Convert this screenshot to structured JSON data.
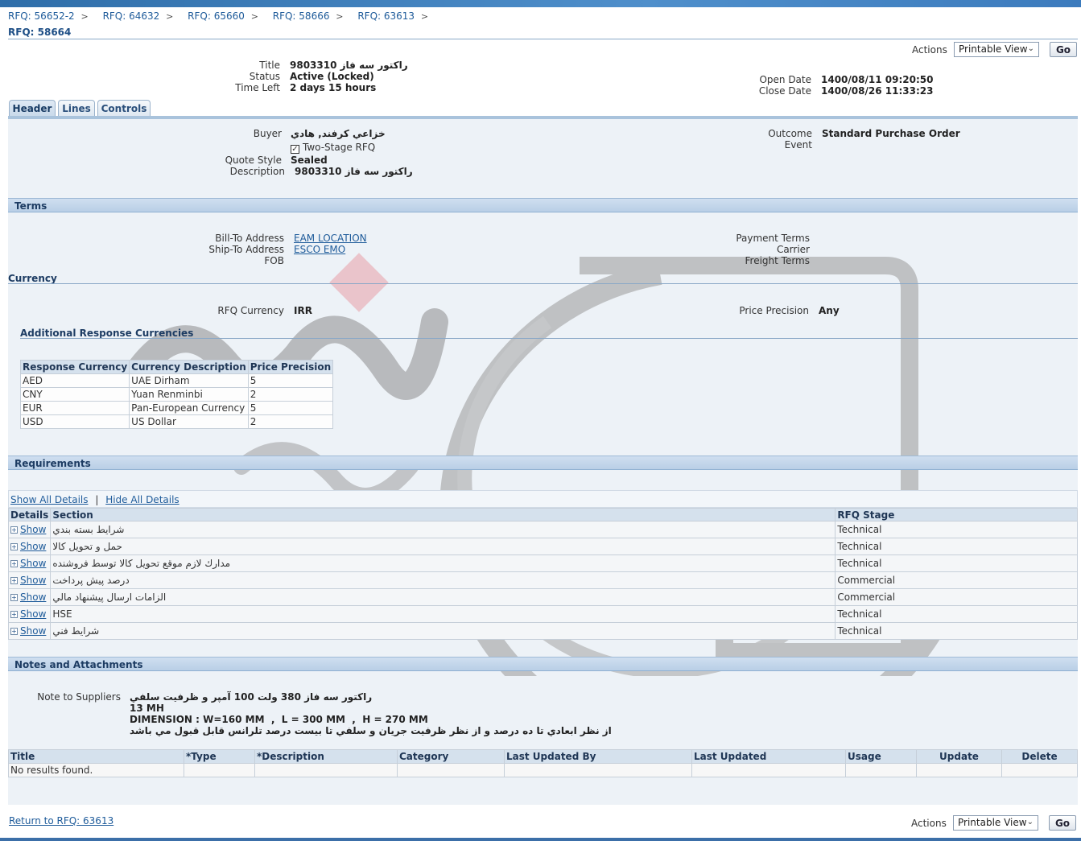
{
  "breadcrumbs": [
    "RFQ: 56652-2",
    "RFQ: 64632",
    "RFQ: 65660",
    "RFQ: 58666",
    "RFQ: 63613"
  ],
  "breadcrumb_sep": ">",
  "page_title": "RFQ: 58664",
  "actions": {
    "label": "Actions",
    "selected": "Printable View",
    "go": "Go"
  },
  "header_info": {
    "title_label": "Title",
    "title_value": "9803310 راكتور سه فاز",
    "status_label": "Status",
    "status_value": "Active (Locked)",
    "timeleft_label": "Time Left",
    "timeleft_value": "2 days 15 hours",
    "open_label": "Open Date",
    "open_value": "1400/08/11 09:20:50",
    "close_label": "Close Date",
    "close_value": "1400/08/26 11:33:23"
  },
  "tabs": [
    "Header",
    "Lines",
    "Controls"
  ],
  "header_panel": {
    "buyer_label": "Buyer",
    "buyer_value": "خزاعي كرفند, هادي",
    "two_stage": "Two-Stage RFQ",
    "quote_style_label": "Quote Style",
    "quote_style_value": "Sealed",
    "description_label": "Description",
    "description_value": "9803310 راكتور سه فاز",
    "outcome_label": "Outcome",
    "outcome_value": "Standard Purchase Order",
    "event_label": "Event"
  },
  "terms": {
    "title": "Terms",
    "bill_to_label": "Bill-To Address",
    "bill_to_value": "EAM LOCATION",
    "ship_to_label": "Ship-To Address",
    "ship_to_value": "ESCO EMO",
    "fob_label": "FOB",
    "payment_label": "Payment Terms",
    "carrier_label": "Carrier",
    "freight_label": "Freight Terms"
  },
  "currency": {
    "title": "Currency",
    "rfq_currency_label": "RFQ Currency",
    "rfq_currency_value": "IRR",
    "price_precision_label": "Price Precision",
    "price_precision_value": "Any",
    "additional_title": "Additional Response Currencies",
    "columns": [
      "Response Currency",
      "Currency Description",
      "Price Precision"
    ],
    "rows": [
      [
        "AED",
        "UAE Dirham",
        "5"
      ],
      [
        "CNY",
        "Yuan Renminbi",
        "2"
      ],
      [
        "EUR",
        "Pan-European Currency",
        "5"
      ],
      [
        "USD",
        "US Dollar",
        "2"
      ]
    ]
  },
  "requirements": {
    "title": "Requirements",
    "show_all": "Show All Details",
    "hide_all": "Hide All Details",
    "columns": [
      "Details",
      "Section",
      "RFQ Stage"
    ],
    "show_label": "Show",
    "rows": [
      {
        "section": "شرايط بسته بندي",
        "stage": "Technical"
      },
      {
        "section": "حمل و تحويل كالا",
        "stage": "Technical"
      },
      {
        "section": "مدارك لازم موقع تحويل كالا توسط فروشنده",
        "stage": "Technical"
      },
      {
        "section": "درصد پيش پرداخت",
        "stage": "Commercial"
      },
      {
        "section": "الزامات ارسال پيشنهاد مالي",
        "stage": "Commercial"
      },
      {
        "section": "HSE",
        "stage": "Technical"
      },
      {
        "section": "شرايط فني",
        "stage": "Technical"
      }
    ]
  },
  "notes": {
    "title": "Notes and Attachments",
    "note_label": "Note to Suppliers",
    "note_lines": [
      "راكتور سه فاز 380 ولت 100 آمپر و ظرفيت سلفي",
      "13 MH",
      "DIMENSION : W=160 MM  ,  L = 300 MM  ,  H = 270 MM",
      "از نظر ابعادي تا ده درصد و از نظر ظرفيت جريان و سلفي تا بيست درصد تلرانس قابل قبول مي باشد"
    ],
    "columns": [
      "Title",
      "*Type",
      "*Description",
      "Category",
      "Last Updated By",
      "Last Updated",
      "Usage",
      "Update",
      "Delete"
    ],
    "empty": "No results found."
  },
  "return_link": "Return to RFQ: 63613",
  "colors": {
    "accent": "#1e5b9a",
    "section_header": "#c3d7ec",
    "panel": "#edf2f7",
    "watermark_red": "#e8a0a8"
  }
}
